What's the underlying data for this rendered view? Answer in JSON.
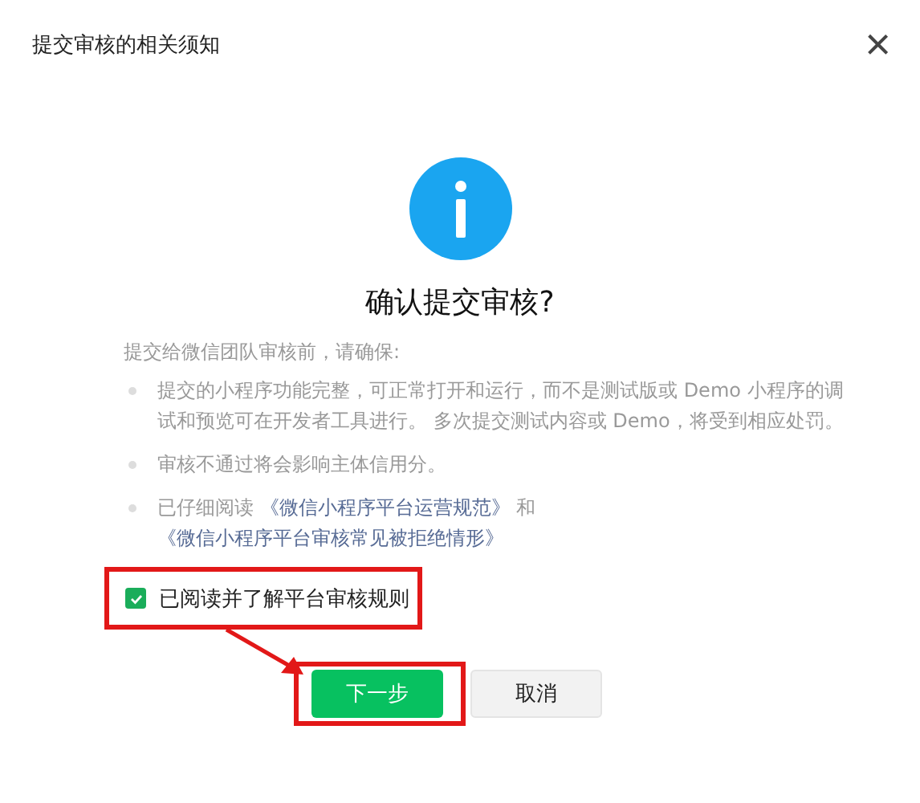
{
  "dialog": {
    "title": "提交审核的相关须知",
    "close": "×"
  },
  "heading": "确认提交审核?",
  "intro": "提交给微信团队审核前，请确保:",
  "bullets": [
    {
      "parts": [
        {
          "kind": "text",
          "text": "提交的小程序功能完整，可正常打开和运行，而不是测试版或 Demo 小程序的调试和预览可在开发者工具进行。 多次提交测试内容或 Demo，将受到相应处罚。"
        }
      ]
    },
    {
      "parts": [
        {
          "kind": "text",
          "text": "审核不通过将会影响主体信用分。"
        }
      ]
    },
    {
      "parts": [
        {
          "kind": "text",
          "text": "已仔细阅读 "
        },
        {
          "kind": "link",
          "text": "《微信小程序平台运营规范》"
        },
        {
          "kind": "text",
          "text": " 和 "
        },
        {
          "kind": "link",
          "text": "《微信小程序平台审核常见被拒绝情形》"
        }
      ]
    }
  ],
  "agreement": {
    "label": "已阅读并了解平台审核规则",
    "checked": true
  },
  "buttons": [
    {
      "label": "下一步",
      "kind": "primary"
    },
    {
      "label": "取消",
      "kind": "secondary"
    }
  ]
}
